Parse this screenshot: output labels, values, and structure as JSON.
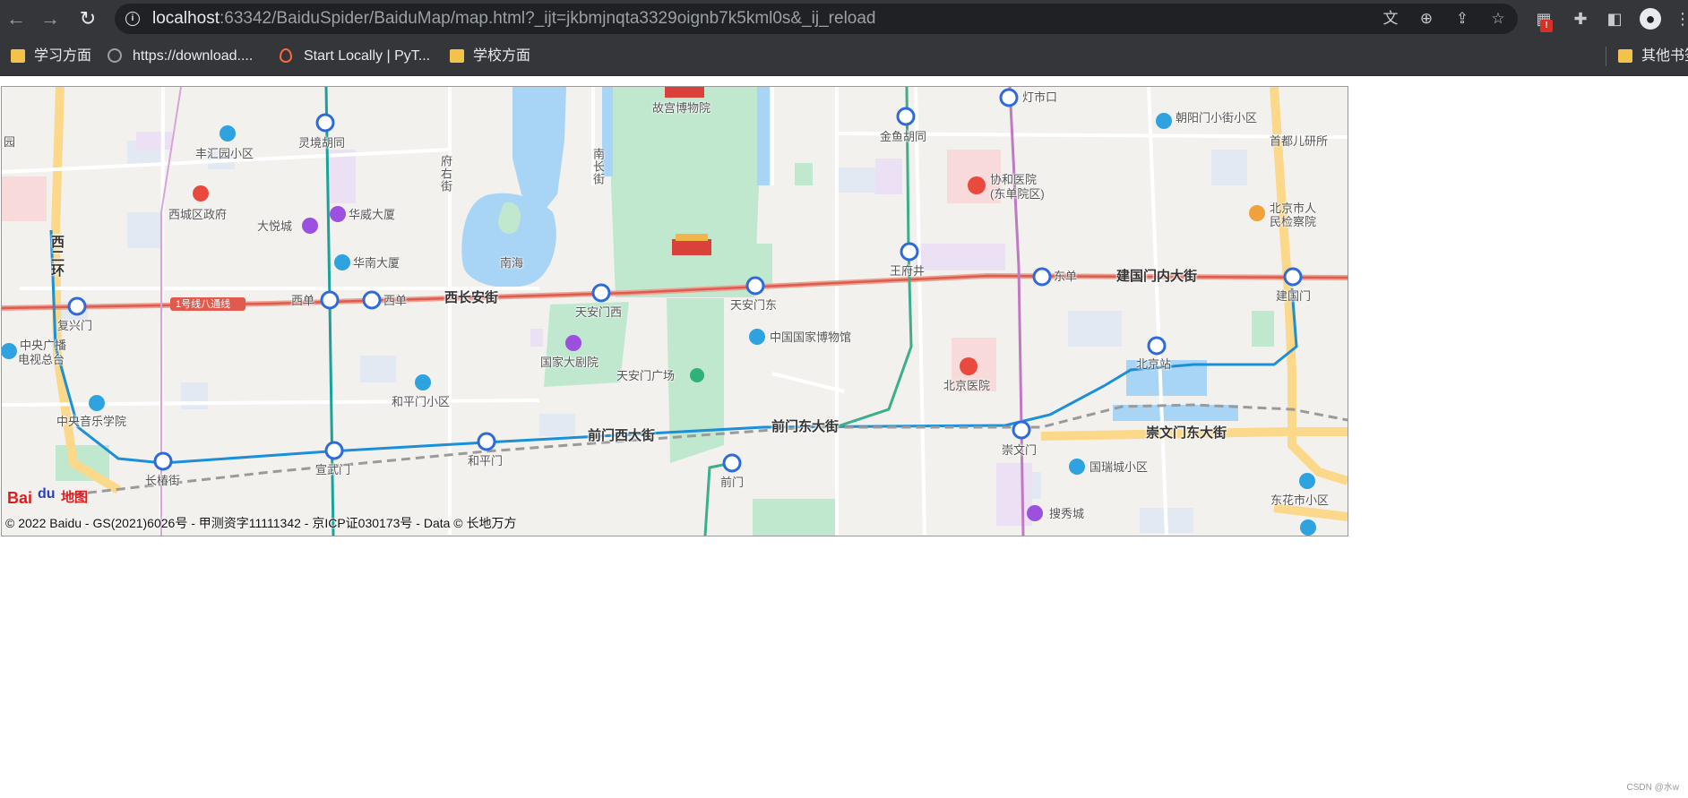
{
  "browser": {
    "url_host": "localhost",
    "url_rest": ":63342/BaiduSpider/BaiduMap/map.html?_ijt=jkbmjnqta3329oignb7k5kml0s&_ij_reload",
    "icons": [
      "back-arrow-icon",
      "forward-arrow-icon",
      "reload-icon",
      "info-icon",
      "translate-icon",
      "zoom-icon",
      "share-icon",
      "star-icon",
      "extension-icon",
      "puzzle-icon",
      "sidepanel-icon",
      "profile-icon",
      "menu-icon"
    ],
    "ext_badge": "!"
  },
  "bookmarks": {
    "items": [
      "学习方面",
      "https://download....",
      "Start Locally | PyT...",
      "学校方面"
    ],
    "other": "其他书签"
  },
  "map": {
    "places": [
      "故宫博物院",
      "灯市口",
      "朝阳门小街小区",
      "首都儿研所",
      "丰汇园小区",
      "灵境胡同",
      "金鱼胡同",
      "协和医院",
      "(东单院区)",
      "北京市人",
      "民检察院",
      "西城区政府",
      "华威大厦",
      "大悦城",
      "华南大厦",
      "南海",
      "王府井",
      "东单",
      "建国门",
      "复兴门",
      "西单",
      "西单",
      "天安门西",
      "天安门东",
      "中国国家博物馆",
      "中央广播",
      "电视总台",
      "国家大剧院",
      "天安门广场",
      "北京站",
      "北京医院",
      "和平门小区",
      "中央音乐学院",
      "长椿街",
      "宣武门",
      "和平门",
      "前门",
      "崇文门",
      "国瑞城小区",
      "东花市小区",
      "搜秀城",
      "园"
    ],
    "vertical": [
      "府右街",
      "南长街",
      "西二环"
    ],
    "roads": [
      "西长安街",
      "建国门内大街",
      "前门西大街",
      "前门东大街",
      "崇文门东大街"
    ],
    "line_badge": "1号线八通线",
    "logo_bai": "Bai",
    "logo_du": "du",
    "logo_map": "地图",
    "copyright": "© 2022 Baidu - GS(2021)6026号 - 甲测资字11111342 - 京ICP证030173号 - Data © 长地万方"
  },
  "colors": {
    "line1": "#e05a4e",
    "line2": "#1b8fd8",
    "line4": "#1aa29a",
    "line5": "#c07ac4",
    "line8": "#3cae8a",
    "park": "#bfe8cf",
    "water": "#a8d4f5"
  },
  "footer": {
    "watermark": "CSDN @水w"
  }
}
